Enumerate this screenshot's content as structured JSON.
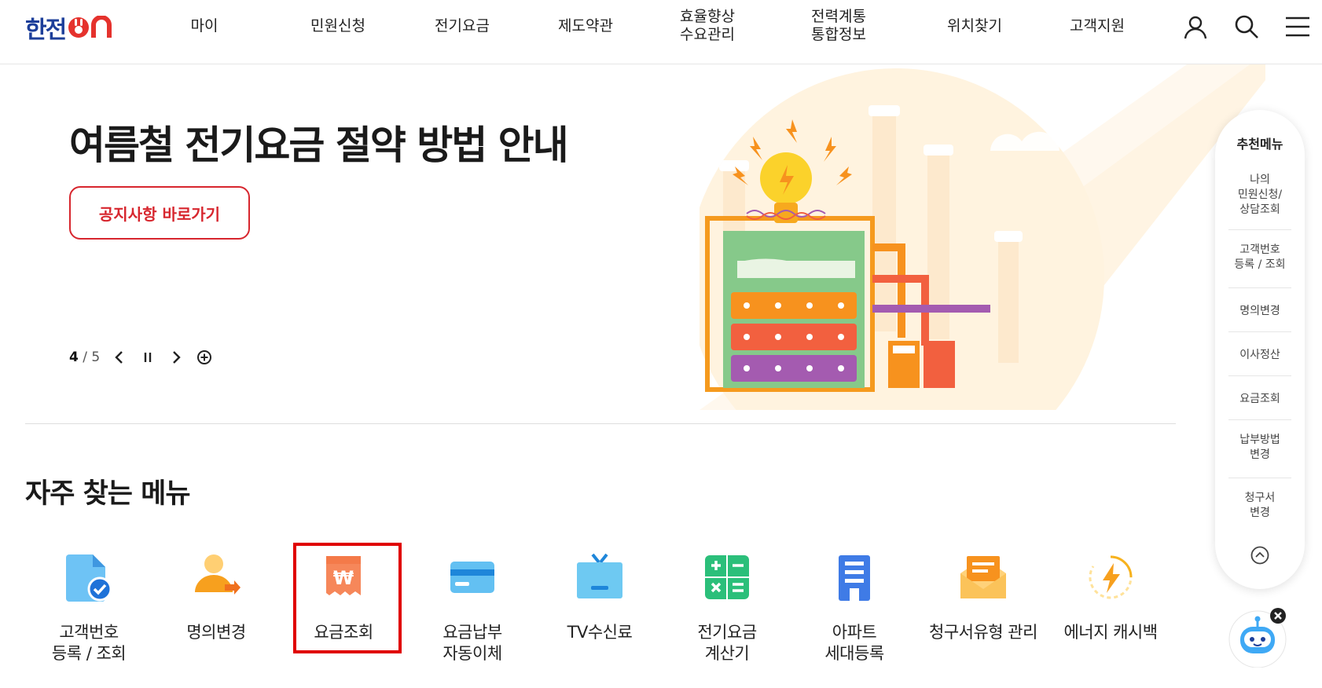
{
  "header": {
    "logo_text": "한전",
    "nav": [
      {
        "label": "마이"
      },
      {
        "label": "민원신청"
      },
      {
        "label": "전기요금"
      },
      {
        "label": "제도약관"
      },
      {
        "label": "효율향상\n수요관리"
      },
      {
        "label": "전력계통\n통합정보"
      },
      {
        "label": "위치찾기"
      },
      {
        "label": "고객지원"
      }
    ],
    "icons": [
      "user-icon",
      "search-icon",
      "menu-icon"
    ]
  },
  "hero": {
    "title": "여름철 전기요금 절약 방법 안내",
    "button_label": "공지사항 바로가기",
    "slide_current": "4",
    "slide_total": "5"
  },
  "frequent": {
    "title": "자주 찾는 메뉴",
    "items": [
      {
        "label": "고객번호\n등록 / 조회",
        "icon": "document-check-icon"
      },
      {
        "label": "명의변경",
        "icon": "person-change-icon"
      },
      {
        "label": "요금조회",
        "icon": "won-receipt-icon"
      },
      {
        "label": "요금납부\n자동이체",
        "icon": "card-icon"
      },
      {
        "label": "TV수신료",
        "icon": "tv-icon"
      },
      {
        "label": "전기요금\n계산기",
        "icon": "calculator-icon"
      },
      {
        "label": "아파트\n세대등록",
        "icon": "apartment-icon"
      },
      {
        "label": "청구서유형 관리",
        "icon": "envelope-icon"
      },
      {
        "label": "에너지 캐시백",
        "icon": "energy-cashback-icon"
      }
    ]
  },
  "side_menu": {
    "title": "추천메뉴",
    "items": [
      {
        "label": "나의\n민원신청/\n상담조회"
      },
      {
        "label": "고객번호\n등록 / 조회"
      },
      {
        "label": "명의변경"
      },
      {
        "label": "이사정산"
      },
      {
        "label": "요금조회"
      },
      {
        "label": "납부방법\n변경"
      },
      {
        "label": "청구서\n변경"
      }
    ]
  },
  "colors": {
    "brand_blue": "#1d3f9a",
    "brand_red": "#d7262e",
    "highlight": "#e00000"
  }
}
